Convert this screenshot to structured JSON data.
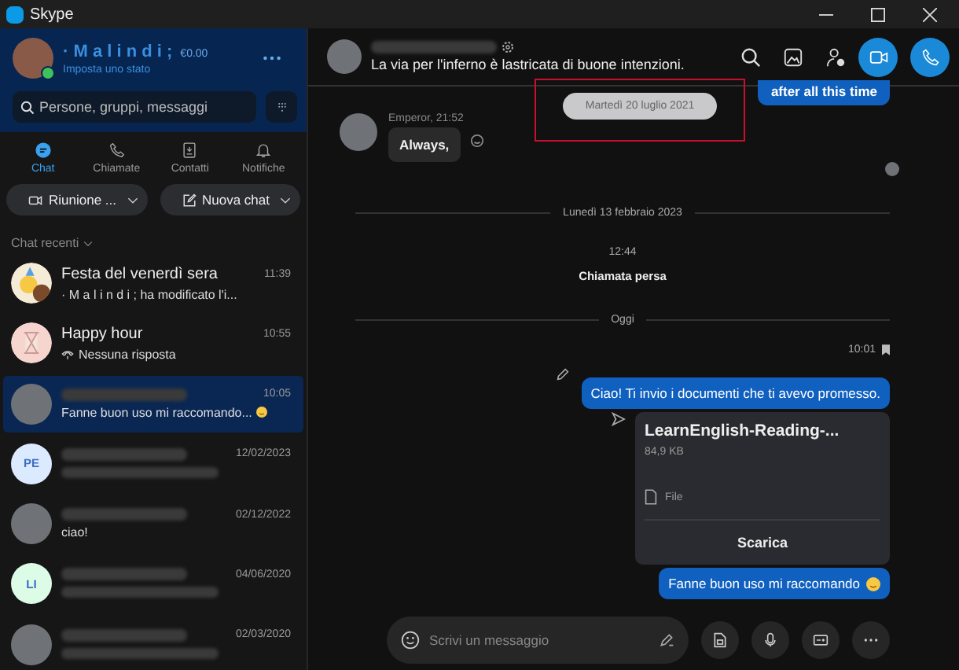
{
  "window": {
    "title": "Skype"
  },
  "profile": {
    "name": "· M a l i n d i ;",
    "credit": "€0.00",
    "status": "Imposta uno stato"
  },
  "search": {
    "placeholder": "Persone, gruppi, messaggi"
  },
  "tabs": [
    {
      "label": "Chat",
      "selected": true,
      "kind": "chat"
    },
    {
      "label": "Chiamate",
      "selected": false,
      "kind": "call"
    },
    {
      "label": "Contatti",
      "selected": false,
      "kind": "contacts"
    },
    {
      "label": "Notifiche",
      "selected": false,
      "kind": "bell"
    }
  ],
  "actions": [
    {
      "label": "Riunione ...",
      "kind": "meeting"
    },
    {
      "label": "Nuova chat",
      "kind": "compose"
    }
  ],
  "recent_header": "Chat recenti",
  "chats": [
    {
      "name": "Festa del venerdì sera",
      "time": "11:39",
      "preview": "· M a l i n d i ; ha modificato l'i...",
      "avatar": {
        "kind": "party"
      },
      "selected": false
    },
    {
      "name": "Happy hour",
      "time": "10:55",
      "preview": "Nessuna risposta",
      "preview_icon": {
        "kind": "call"
      },
      "avatar": {
        "kind": "hourglass"
      },
      "selected": false
    },
    {
      "time": "10:05",
      "preview": "Fanne buon uso mi raccomando...",
      "preview_icon": {
        "kind": "smiley"
      },
      "avatar": {
        "kind": "photo"
      },
      "selected": true
    },
    {
      "time": "12/02/2023",
      "avatar": {
        "kind": "initials",
        "initials": "PE",
        "color": "#dbeafe"
      },
      "selected": false
    },
    {
      "time": "02/12/2022",
      "preview": "ciao!",
      "avatar": {
        "kind": "photo"
      },
      "selected": false
    },
    {
      "time": "04/06/2020",
      "avatar": {
        "kind": "initials",
        "initials": "LI",
        "color": "#dcfce7"
      },
      "selected": false
    },
    {
      "time": "02/03/2020",
      "avatar": {
        "kind": "photo"
      },
      "selected": false
    }
  ],
  "conversation": {
    "status": "La via per l'inferno è lastricata di buone intenzioni."
  },
  "messages": [
    {
      "kind": "outgoing",
      "text": "after all this time"
    },
    {
      "kind": "date_pill",
      "text": "Martedì 20 luglio 2021"
    },
    {
      "kind": "incoming",
      "sender": "Emperor, 21:52",
      "text": "Always,"
    },
    {
      "kind": "read_receipt"
    },
    {
      "kind": "divider",
      "text": "Lunedì 13 febbraio 2023"
    },
    {
      "kind": "event",
      "time": "12:44",
      "text": "Chiamata persa"
    },
    {
      "kind": "divider",
      "text": "Oggi"
    },
    {
      "kind": "timestamp",
      "text": "10:01"
    },
    {
      "kind": "outgoing",
      "text": "Ciao! Ti invio i documenti che ti avevo promesso.",
      "edited": true
    },
    {
      "kind": "file",
      "name": "LearnEnglish-Reading-...",
      "size": "84,9 KB",
      "type": "File",
      "action": "Scarica"
    },
    {
      "kind": "outgoing",
      "text": "Fanne buon uso mi raccomando",
      "emoji": true
    }
  ],
  "composer": {
    "placeholder": "Scrivi un messaggio"
  }
}
